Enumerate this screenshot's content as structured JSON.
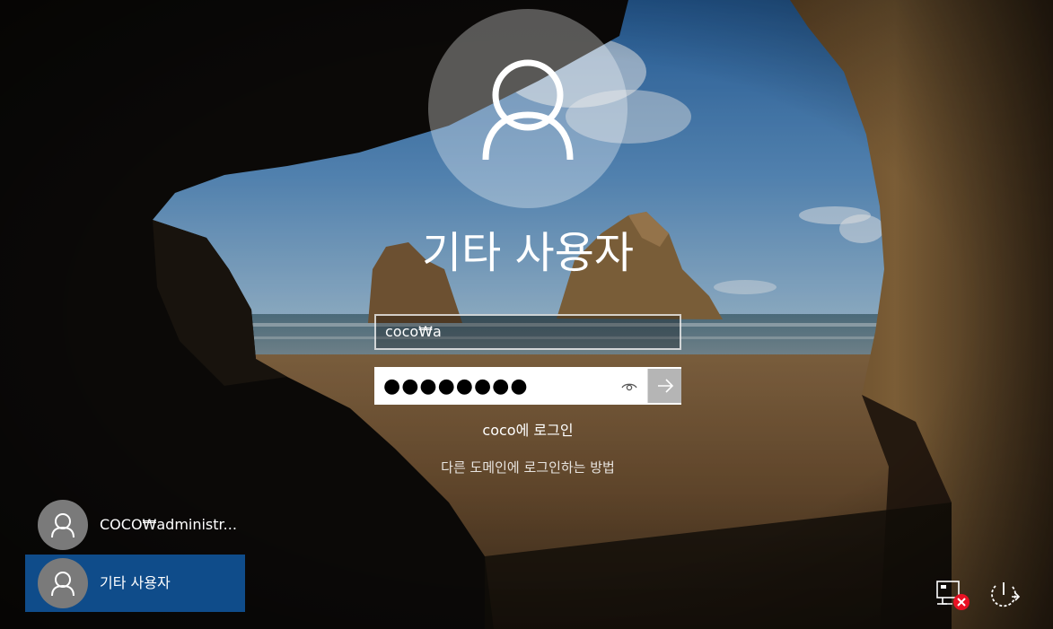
{
  "window": {
    "title": "기타 사용자"
  },
  "login": {
    "account_value": "coco₩a",
    "password_value": "●●●●●●●●",
    "password_mask": "password",
    "signin_to": "coco에 로그인",
    "other_domain_link": "다른 도메인에 로그인하는 방법"
  },
  "users": [
    {
      "label": "COCO₩administr...",
      "selected": false
    },
    {
      "label": "기타 사용자",
      "selected": true
    }
  ],
  "system_icons": {
    "network": "network-disconnected-icon",
    "power": "power-icon"
  },
  "colors": {
    "selected_tile": "#0f4c8a",
    "avatar_tile": "#7a7a7a",
    "error_badge": "#e81123"
  }
}
